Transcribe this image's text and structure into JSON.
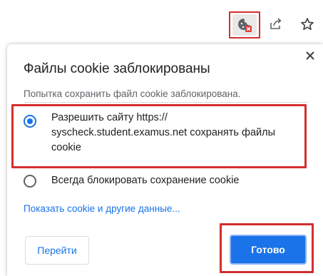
{
  "toolbar": {
    "cookie_icon": "cookie-blocked-icon",
    "share_icon": "share-icon",
    "star_icon": "star-icon"
  },
  "dialog": {
    "title": "Файлы cookie заблокированы",
    "subtitle": "Попытка сохранить файл cookie заблокирована.",
    "options": [
      {
        "label": "Разрешить сайту https:// syscheck.student.examus.net сохранять файлы cookie",
        "selected": true
      },
      {
        "label": "Всегда блокировать сохранение cookie",
        "selected": false
      }
    ],
    "link": "Показать cookie и другие данные...",
    "go_button": "Перейти",
    "done_button": "Готово"
  },
  "colors": {
    "accent": "#1a73e8",
    "highlight": "#d32f2f",
    "blocked_badge": "#e53935"
  }
}
